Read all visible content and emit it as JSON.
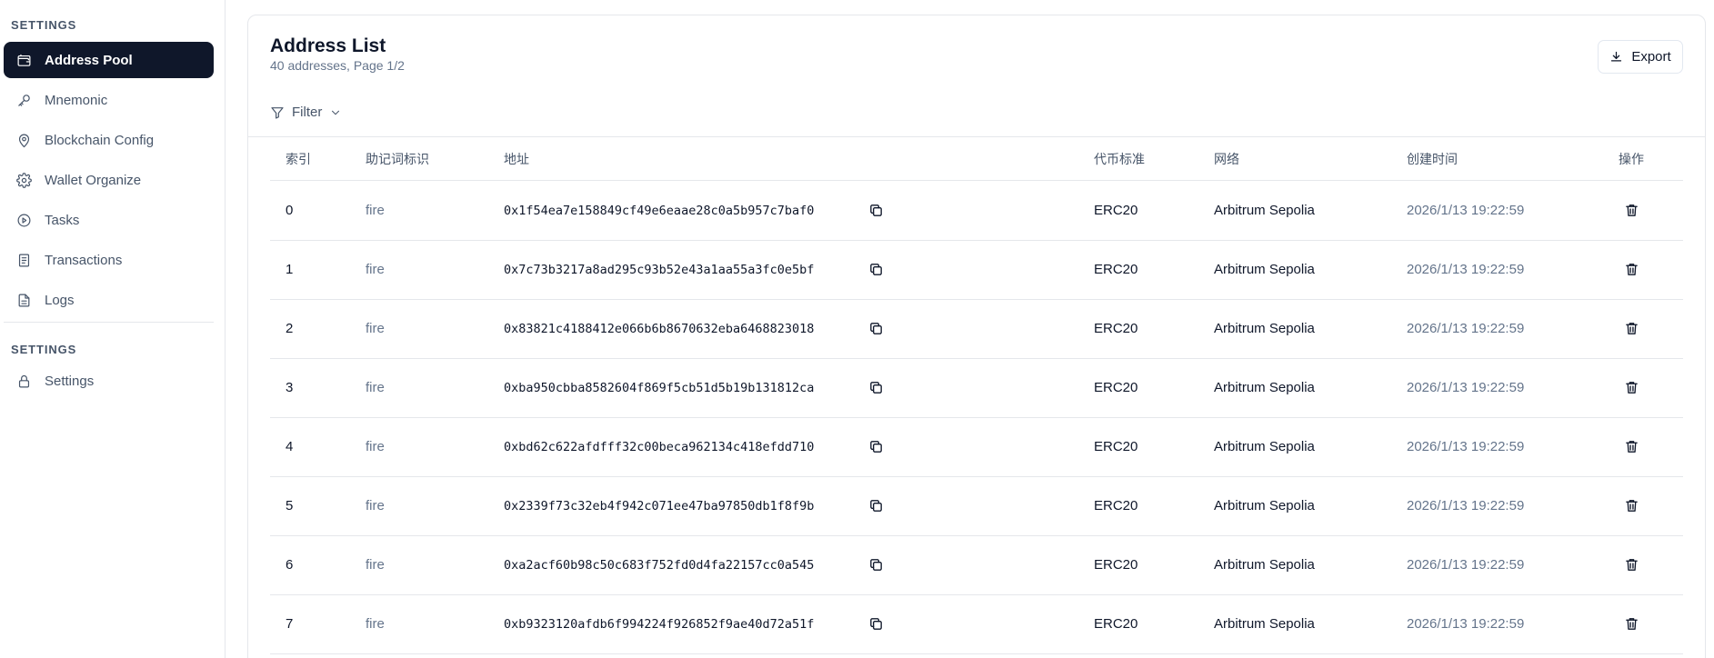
{
  "sidebar": {
    "section1_label": "SETTINGS",
    "items": [
      {
        "label": "Address Pool",
        "icon": "wallet-icon",
        "active": true
      },
      {
        "label": "Mnemonic",
        "icon": "key-icon"
      },
      {
        "label": "Blockchain Config",
        "icon": "map-pin-icon"
      },
      {
        "label": "Wallet Organize",
        "icon": "gear-icon"
      },
      {
        "label": "Tasks",
        "icon": "play-circle-icon"
      },
      {
        "label": "Transactions",
        "icon": "receipt-icon"
      },
      {
        "label": "Logs",
        "icon": "file-text-icon"
      }
    ],
    "section2_label": "SETTINGS",
    "settings_item": {
      "label": "Settings",
      "icon": "lock-icon"
    }
  },
  "main": {
    "title": "Address List",
    "subtitle": "40 addresses, Page 1/2",
    "export_label": "Export",
    "filter_label": "Filter"
  },
  "table": {
    "headers": {
      "index": "索引",
      "mnemonic": "助记词标识",
      "address": "地址",
      "standard": "代币标准",
      "network": "网络",
      "created": "创建时间",
      "actions": "操作"
    },
    "rows": [
      {
        "index": "0",
        "mnemonic": "fire",
        "address": "0x1f54ea7e158849cf49e6eaae28c0a5b957c7baf0",
        "standard": "ERC20",
        "network": "Arbitrum Sepolia",
        "created": "2026/1/13 19:22:59"
      },
      {
        "index": "1",
        "mnemonic": "fire",
        "address": "0x7c73b3217a8ad295c93b52e43a1aa55a3fc0e5bf",
        "standard": "ERC20",
        "network": "Arbitrum Sepolia",
        "created": "2026/1/13 19:22:59"
      },
      {
        "index": "2",
        "mnemonic": "fire",
        "address": "0x83821c4188412e066b6b8670632eba6468823018",
        "standard": "ERC20",
        "network": "Arbitrum Sepolia",
        "created": "2026/1/13 19:22:59"
      },
      {
        "index": "3",
        "mnemonic": "fire",
        "address": "0xba950cbba8582604f869f5cb51d5b19b131812ca",
        "standard": "ERC20",
        "network": "Arbitrum Sepolia",
        "created": "2026/1/13 19:22:59"
      },
      {
        "index": "4",
        "mnemonic": "fire",
        "address": "0xbd62c622afdfff32c00beca962134c418efdd710",
        "standard": "ERC20",
        "network": "Arbitrum Sepolia",
        "created": "2026/1/13 19:22:59"
      },
      {
        "index": "5",
        "mnemonic": "fire",
        "address": "0x2339f73c32eb4f942c071ee47ba97850db1f8f9b",
        "standard": "ERC20",
        "network": "Arbitrum Sepolia",
        "created": "2026/1/13 19:22:59"
      },
      {
        "index": "6",
        "mnemonic": "fire",
        "address": "0xa2acf60b98c50c683f752fd0d4fa22157cc0a545",
        "standard": "ERC20",
        "network": "Arbitrum Sepolia",
        "created": "2026/1/13 19:22:59"
      },
      {
        "index": "7",
        "mnemonic": "fire",
        "address": "0xb9323120afdb6f994224f926852f9ae40d72a51f",
        "standard": "ERC20",
        "network": "Arbitrum Sepolia",
        "created": "2026/1/13 19:22:59"
      }
    ]
  },
  "colors": {
    "active_nav_bg": "#0f172a",
    "text_primary": "#0f172a",
    "text_muted": "#64748b",
    "border": "#e5e7eb"
  }
}
